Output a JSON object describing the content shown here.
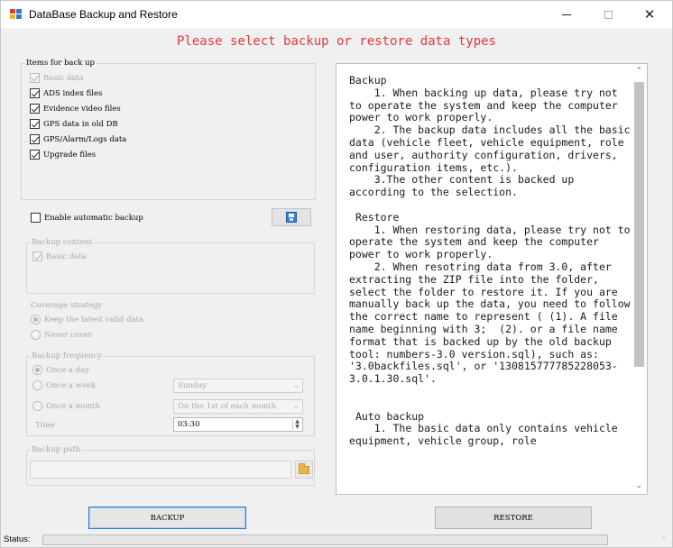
{
  "window": {
    "title": "DataBase Backup and Restore",
    "close_glyph": "✕"
  },
  "headline": "Please select backup or restore data types",
  "items_group": {
    "legend": "Items for back up",
    "items": [
      {
        "label": "Basic data",
        "checked": true,
        "enabled": false
      },
      {
        "label": "ADS index files",
        "checked": true,
        "enabled": true
      },
      {
        "label": "Evidence video files",
        "checked": true,
        "enabled": true
      },
      {
        "label": "GPS data in old DB",
        "checked": true,
        "enabled": true
      },
      {
        "label": "GPS/Alarm/Logs data",
        "checked": true,
        "enabled": true
      },
      {
        "label": "Upgrade files",
        "checked": true,
        "enabled": true
      }
    ]
  },
  "auto_backup": {
    "label": "Enable automatic backup",
    "checked": false,
    "save_icon": "floppy-disk-icon"
  },
  "backup_content": {
    "legend": "Backup content",
    "item_label": "Basic data"
  },
  "coverage_strategy": {
    "legend": "Coverage strategy",
    "options": [
      "Keep the latest valid data",
      "Never cover"
    ],
    "selected": 0
  },
  "backup_frequency": {
    "legend": "Backup frequency",
    "options": [
      "Once a day",
      "Once a week",
      "Once a month"
    ],
    "selected": 0,
    "week_value": "Sunday",
    "month_value": "On the 1st of each month",
    "time_label": "Time",
    "time_value": "03:30"
  },
  "backup_path": {
    "legend": "Backup path",
    "value": "",
    "folder_icon": "folder-icon"
  },
  "info_text": "Backup\n    1. When backing up data, please try not to operate the system and keep the computer power to work properly.\n    2. The backup data includes all the basic data (vehicle fleet, vehicle equipment, role and user, authority configuration, drivers, configuration items, etc.).\n    3.The other content is backed up according to the selection.\n\n Restore\n    1. When restoring data, please try not to operate the system and keep the computer power to work properly.\n    2. When resotring data from 3.0, after extracting the ZIP file into the folder, select the folder to restore it. If you are manually back up the data, you need to follow the correct name to represent ( (1). A file name beginning with 3;  (2). or a file name format that is backed up by the old backup tool: numbers-3.0 version.sql), such as: '3.0backfiles.sql', or '130815777785228053-3.0.1.30.sql'.\n\n\n Auto backup\n    1. The basic data only contains vehicle equipment, vehicle group, role",
  "buttons": {
    "backup": "BACKUP",
    "restore": "RESTORE"
  },
  "status": {
    "label": "Status:"
  },
  "colors": {
    "headline": "#e0393e",
    "focus_border": "#2a7bd4"
  }
}
